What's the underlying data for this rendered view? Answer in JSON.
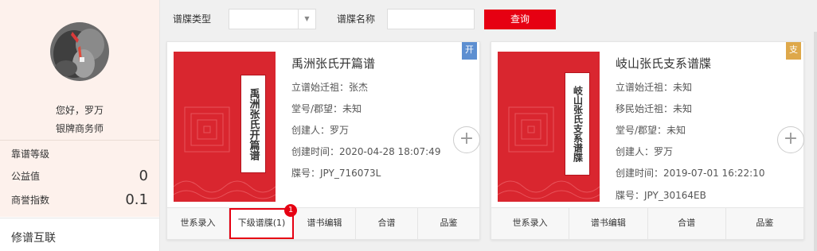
{
  "sidebar": {
    "greeting": "您好，罗万",
    "rank": "银牌商务师",
    "stats": [
      {
        "label": "靠谱等级",
        "value": ""
      },
      {
        "label": "公益值",
        "value": "0"
      },
      {
        "label": "商誉指数",
        "value": "0.1"
      }
    ],
    "section_title": "修谱互联"
  },
  "filter": {
    "type_label": "谱牒类型",
    "type_value": "",
    "name_label": "谱牒名称",
    "name_value": "",
    "search_label": "查询"
  },
  "cards": [
    {
      "title": "禹洲张氏开篇谱",
      "cover_text": "禹洲张氏开篇谱",
      "corner": "开",
      "info": [
        "立谱始迁祖：张杰",
        "堂号/郡望：未知",
        "创建人：罗万",
        "创建时间：2020-04-28 18:07:49",
        "牒号：JPY_716073L"
      ],
      "actions": [
        {
          "label": "世系录入",
          "active": false
        },
        {
          "label": "下级谱牒(1)",
          "active": true,
          "badge": "1"
        },
        {
          "label": "谱书编辑",
          "active": false
        },
        {
          "label": "合谱",
          "active": false
        },
        {
          "label": "品鉴",
          "active": false
        }
      ]
    },
    {
      "title": "岐山张氏支系谱牒",
      "cover_text": "岐山张氏支系谱牒",
      "corner": "支",
      "info": [
        "立谱始迁祖：未知",
        "移民始迁祖：未知",
        "堂号/郡望：未知",
        "创建人：罗万",
        "创建时间：2019-07-01 16:22:10",
        "牒号：JPY_30164EB"
      ],
      "actions": [
        {
          "label": "世系录入",
          "active": false
        },
        {
          "label": "谱书编辑",
          "active": false
        },
        {
          "label": "合谱",
          "active": false
        },
        {
          "label": "品鉴",
          "active": false
        }
      ]
    }
  ],
  "colors": {
    "accent": "#e60012",
    "cover": "#d9262f",
    "profile_bg": "#fdf1ec",
    "tag_blue": "#5d8fd1",
    "tag_orange": "#dea84a"
  },
  "icons": {
    "select_arrow": "chevron-down-icon",
    "expand": "plus-icon"
  }
}
